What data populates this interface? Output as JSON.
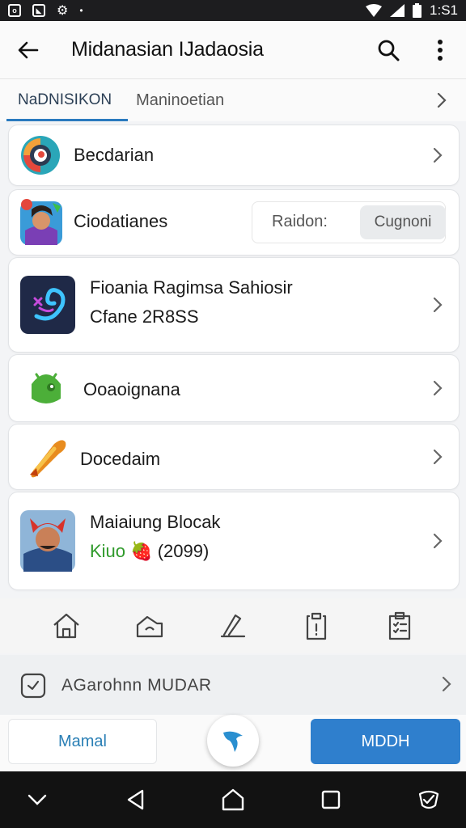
{
  "status_bar": {
    "time": "1:S1"
  },
  "app_bar": {
    "title": "Midanasian IJadaosia"
  },
  "tabs": [
    {
      "label": "NaDNISIKON"
    },
    {
      "label": "Maninoetian"
    }
  ],
  "list": [
    {
      "title": "Becdarian"
    },
    {
      "title": "Ciodatianes",
      "input_label": "Raidon:",
      "button_label": "Cugnoni"
    },
    {
      "title": "Fioania Ragimsa Sahiosir",
      "subtitle": "Cfane 2R8SS"
    },
    {
      "title": "Ooaoignana"
    },
    {
      "title": "Docedaim"
    },
    {
      "title": "Maiaiung Blocak",
      "subtitle_prefix": "Kiuo",
      "subtitle_suffix": "(2099)"
    }
  ],
  "bottom_nav": [
    "home-icon",
    "house-outline-icon",
    "pen-icon",
    "clipboard-icon",
    "checklist-icon"
  ],
  "promo": {
    "text": "AGarohnn  MUDAR"
  },
  "actions": {
    "left_label": "Mamal",
    "right_label": "MDDH"
  },
  "colors": {
    "accent": "#2a7abf",
    "primary_button": "#2f7fcd",
    "status_bar": "#1d1d1f",
    "nav_bar": "#121212"
  }
}
